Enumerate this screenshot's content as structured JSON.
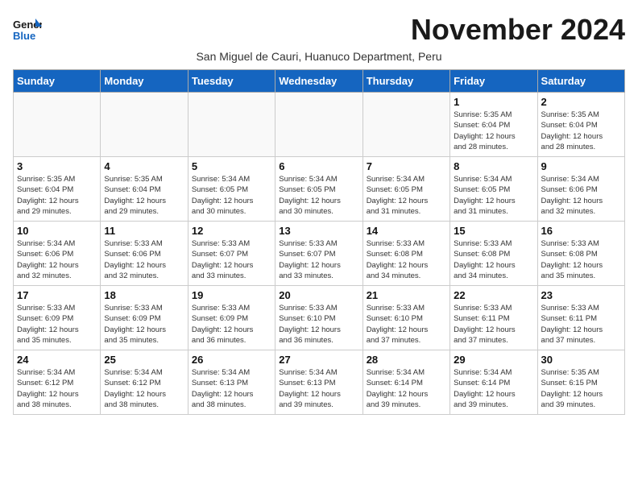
{
  "logo": {
    "text_general": "General",
    "text_blue": "Blue"
  },
  "title": "November 2024",
  "subtitle": "San Miguel de Cauri, Huanuco Department, Peru",
  "headers": [
    "Sunday",
    "Monday",
    "Tuesday",
    "Wednesday",
    "Thursday",
    "Friday",
    "Saturday"
  ],
  "weeks": [
    [
      {
        "day": "",
        "info": ""
      },
      {
        "day": "",
        "info": ""
      },
      {
        "day": "",
        "info": ""
      },
      {
        "day": "",
        "info": ""
      },
      {
        "day": "",
        "info": ""
      },
      {
        "day": "1",
        "info": "Sunrise: 5:35 AM\nSunset: 6:04 PM\nDaylight: 12 hours\nand 28 minutes."
      },
      {
        "day": "2",
        "info": "Sunrise: 5:35 AM\nSunset: 6:04 PM\nDaylight: 12 hours\nand 28 minutes."
      }
    ],
    [
      {
        "day": "3",
        "info": "Sunrise: 5:35 AM\nSunset: 6:04 PM\nDaylight: 12 hours\nand 29 minutes."
      },
      {
        "day": "4",
        "info": "Sunrise: 5:35 AM\nSunset: 6:04 PM\nDaylight: 12 hours\nand 29 minutes."
      },
      {
        "day": "5",
        "info": "Sunrise: 5:34 AM\nSunset: 6:05 PM\nDaylight: 12 hours\nand 30 minutes."
      },
      {
        "day": "6",
        "info": "Sunrise: 5:34 AM\nSunset: 6:05 PM\nDaylight: 12 hours\nand 30 minutes."
      },
      {
        "day": "7",
        "info": "Sunrise: 5:34 AM\nSunset: 6:05 PM\nDaylight: 12 hours\nand 31 minutes."
      },
      {
        "day": "8",
        "info": "Sunrise: 5:34 AM\nSunset: 6:05 PM\nDaylight: 12 hours\nand 31 minutes."
      },
      {
        "day": "9",
        "info": "Sunrise: 5:34 AM\nSunset: 6:06 PM\nDaylight: 12 hours\nand 32 minutes."
      }
    ],
    [
      {
        "day": "10",
        "info": "Sunrise: 5:34 AM\nSunset: 6:06 PM\nDaylight: 12 hours\nand 32 minutes."
      },
      {
        "day": "11",
        "info": "Sunrise: 5:33 AM\nSunset: 6:06 PM\nDaylight: 12 hours\nand 32 minutes."
      },
      {
        "day": "12",
        "info": "Sunrise: 5:33 AM\nSunset: 6:07 PM\nDaylight: 12 hours\nand 33 minutes."
      },
      {
        "day": "13",
        "info": "Sunrise: 5:33 AM\nSunset: 6:07 PM\nDaylight: 12 hours\nand 33 minutes."
      },
      {
        "day": "14",
        "info": "Sunrise: 5:33 AM\nSunset: 6:08 PM\nDaylight: 12 hours\nand 34 minutes."
      },
      {
        "day": "15",
        "info": "Sunrise: 5:33 AM\nSunset: 6:08 PM\nDaylight: 12 hours\nand 34 minutes."
      },
      {
        "day": "16",
        "info": "Sunrise: 5:33 AM\nSunset: 6:08 PM\nDaylight: 12 hours\nand 35 minutes."
      }
    ],
    [
      {
        "day": "17",
        "info": "Sunrise: 5:33 AM\nSunset: 6:09 PM\nDaylight: 12 hours\nand 35 minutes."
      },
      {
        "day": "18",
        "info": "Sunrise: 5:33 AM\nSunset: 6:09 PM\nDaylight: 12 hours\nand 35 minutes."
      },
      {
        "day": "19",
        "info": "Sunrise: 5:33 AM\nSunset: 6:09 PM\nDaylight: 12 hours\nand 36 minutes."
      },
      {
        "day": "20",
        "info": "Sunrise: 5:33 AM\nSunset: 6:10 PM\nDaylight: 12 hours\nand 36 minutes."
      },
      {
        "day": "21",
        "info": "Sunrise: 5:33 AM\nSunset: 6:10 PM\nDaylight: 12 hours\nand 37 minutes."
      },
      {
        "day": "22",
        "info": "Sunrise: 5:33 AM\nSunset: 6:11 PM\nDaylight: 12 hours\nand 37 minutes."
      },
      {
        "day": "23",
        "info": "Sunrise: 5:33 AM\nSunset: 6:11 PM\nDaylight: 12 hours\nand 37 minutes."
      }
    ],
    [
      {
        "day": "24",
        "info": "Sunrise: 5:34 AM\nSunset: 6:12 PM\nDaylight: 12 hours\nand 38 minutes."
      },
      {
        "day": "25",
        "info": "Sunrise: 5:34 AM\nSunset: 6:12 PM\nDaylight: 12 hours\nand 38 minutes."
      },
      {
        "day": "26",
        "info": "Sunrise: 5:34 AM\nSunset: 6:13 PM\nDaylight: 12 hours\nand 38 minutes."
      },
      {
        "day": "27",
        "info": "Sunrise: 5:34 AM\nSunset: 6:13 PM\nDaylight: 12 hours\nand 39 minutes."
      },
      {
        "day": "28",
        "info": "Sunrise: 5:34 AM\nSunset: 6:14 PM\nDaylight: 12 hours\nand 39 minutes."
      },
      {
        "day": "29",
        "info": "Sunrise: 5:34 AM\nSunset: 6:14 PM\nDaylight: 12 hours\nand 39 minutes."
      },
      {
        "day": "30",
        "info": "Sunrise: 5:35 AM\nSunset: 6:15 PM\nDaylight: 12 hours\nand 39 minutes."
      }
    ]
  ]
}
